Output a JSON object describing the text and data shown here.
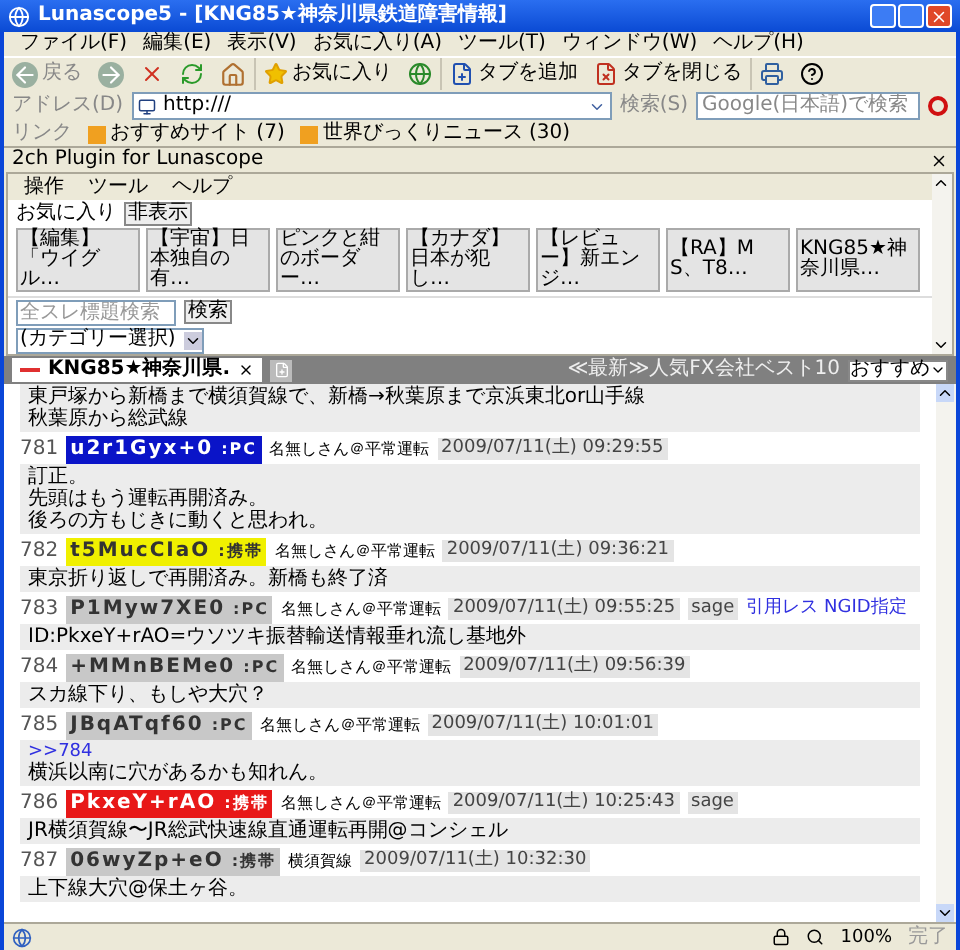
{
  "window": {
    "title": "Lunascope5 - [KNG85★神奈川県鉄道障害情報]"
  },
  "menu": [
    "ファイル(F)",
    "編集(E)",
    "表示(V)",
    "お気に入り(A)",
    "ツール(T)",
    "ウィンドウ(W)",
    "ヘルプ(H)"
  ],
  "toolbar": {
    "back": "戻る",
    "favorites": "お気に入り",
    "add_tab": "タブを追加",
    "close_tab": "タブを閉じる"
  },
  "address": {
    "label": "アドレス(D)",
    "value": "http:///"
  },
  "search": {
    "label": "検索(S)",
    "placeholder": "Google(日本語)で検索"
  },
  "links": {
    "label": "リンク",
    "items": [
      "おすすめサイト (7)",
      "世界びっくりニュース (30)"
    ]
  },
  "plugin": {
    "title": "2ch Plugin for Lunascope",
    "menu": [
      "操作",
      "ツール",
      "ヘルプ"
    ],
    "favorites_label": "お気に入り",
    "hide_button": "非表示",
    "favorites": [
      "【編集】「ウイグル…",
      "【宇宙】日本独自の有…",
      "ピンクと紺のボーダー…",
      "【カナダ】日本が犯し…",
      "【レビュー】新エンジ…",
      "【RA】MS、T8…",
      "KNG85★神奈川県…"
    ],
    "thread_search": {
      "placeholder": "全スレ標題検索",
      "button": "検索"
    },
    "category": "(カテゴリー選択)"
  },
  "tabs": [
    {
      "label": "KNG85★神奈川県.",
      "selected": true
    }
  ],
  "ad": {
    "text": "≪最新≫人気FX会社ベスト10",
    "select": "おすすめ"
  },
  "prev_body": [
    "東戸塚から新橋まで横須賀線で、新橋→秋葉原まで京浜東北or山手線",
    "秋葉原から総武線"
  ],
  "posts": [
    {
      "number": "781",
      "id": "u2r1Gyx+0",
      "device": ":PC",
      "color": "#0a14c8",
      "name": "名無しさん＠平常運転",
      "date": "2009/07/11(土) 09:29:55",
      "body": [
        "訂正。",
        "先頭はもう運転再開済み。",
        "後ろの方もじきに動くと思われ。"
      ]
    },
    {
      "number": "782",
      "id": "t5MucCIaO",
      "device": ":携帯",
      "color": "#f0f000",
      "name": "名無しさん＠平常運転",
      "date": "2009/07/11(土) 09:36:21",
      "body": [
        "東京折り返しで再開済み。新橋も終了済"
      ]
    },
    {
      "number": "783",
      "id": "P1Myw7XE0",
      "device": ":PC",
      "color": "#c8c8c8",
      "name": "名無しさん＠平常運転",
      "date": "2009/07/11(土) 09:55:25",
      "sage": "sage",
      "link": "引用レス NGID指定",
      "body": [
        "ID:PkxeY+rAO=ウソツキ振替輸送情報垂れ流し基地外"
      ]
    },
    {
      "number": "784",
      "id": "+MMnBEMe0",
      "device": ":PC",
      "color": "#c8c8c8",
      "name": "名無しさん＠平常運転",
      "date": "2009/07/11(土) 09:56:39",
      "body": [
        "スカ線下り、もしや大穴？"
      ]
    },
    {
      "number": "785",
      "id": "JBqATqf60",
      "device": ":PC",
      "color": "#c8c8c8",
      "name": "名無しさん＠平常運転",
      "date": "2009/07/11(土) 10:01:01",
      "anchor": ">>784",
      "body": [
        "横浜以南に穴があるかも知れん。"
      ]
    },
    {
      "number": "786",
      "id": "PkxeY+rAO",
      "device": ":携帯",
      "color": "#e81818",
      "name": "名無しさん＠平常運転",
      "date": "2009/07/11(土) 10:25:43",
      "sage": "sage",
      "body": [
        "JR横須賀線〜JR総武快速線直通運転再開@コンシェル"
      ]
    },
    {
      "number": "787",
      "id": "06wyZp+eO",
      "device": ":携帯",
      "color": "#c8c8c8",
      "name": "横須賀線",
      "date": "2009/07/11(土) 10:32:30",
      "body": [
        "上下線大穴@保土ヶ谷。"
      ]
    }
  ],
  "status": {
    "zoom": "100%",
    "text": "完了"
  }
}
